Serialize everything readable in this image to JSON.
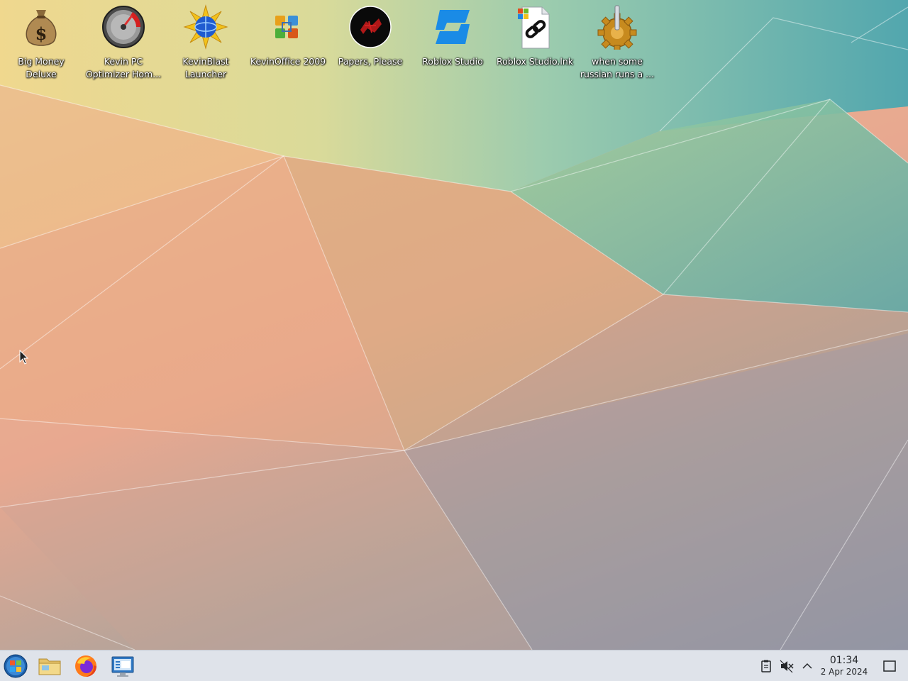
{
  "desktop": {
    "icons": [
      {
        "name": "money-bag-icon",
        "label": "Big Money Deluxe"
      },
      {
        "name": "speedometer-icon",
        "label": "Kevin PC Optimizer Hom..."
      },
      {
        "name": "starburst-globe-icon",
        "label": "KevinBlast Launcher"
      },
      {
        "name": "office-puzzle-icon",
        "label": "KevinOffice 2009"
      },
      {
        "name": "papers-please-icon",
        "label": "Papers, Please"
      },
      {
        "name": "roblox-studio-icon",
        "label": "Roblox Studio"
      },
      {
        "name": "shortcut-link-icon",
        "label": "Roblox Studio.lnk"
      },
      {
        "name": "gear-icon",
        "label": "when some russian runs a ..."
      }
    ]
  },
  "taskbar": {
    "launchers": [
      {
        "name": "start-menu-icon"
      },
      {
        "name": "file-manager-icon"
      },
      {
        "name": "firefox-icon"
      },
      {
        "name": "system-settings-icon"
      }
    ],
    "tray": [
      {
        "name": "clipboard-icon"
      },
      {
        "name": "volume-muted-icon"
      },
      {
        "name": "chevron-up-icon"
      }
    ],
    "clock": {
      "time": "01:34",
      "date": "2 Apr 2024"
    },
    "show_desktop": {
      "name": "show-desktop-icon"
    }
  },
  "colors": {
    "taskbar_bg": "#dfe3ea",
    "label_text": "#ffffff",
    "clock_text": "#232629"
  }
}
